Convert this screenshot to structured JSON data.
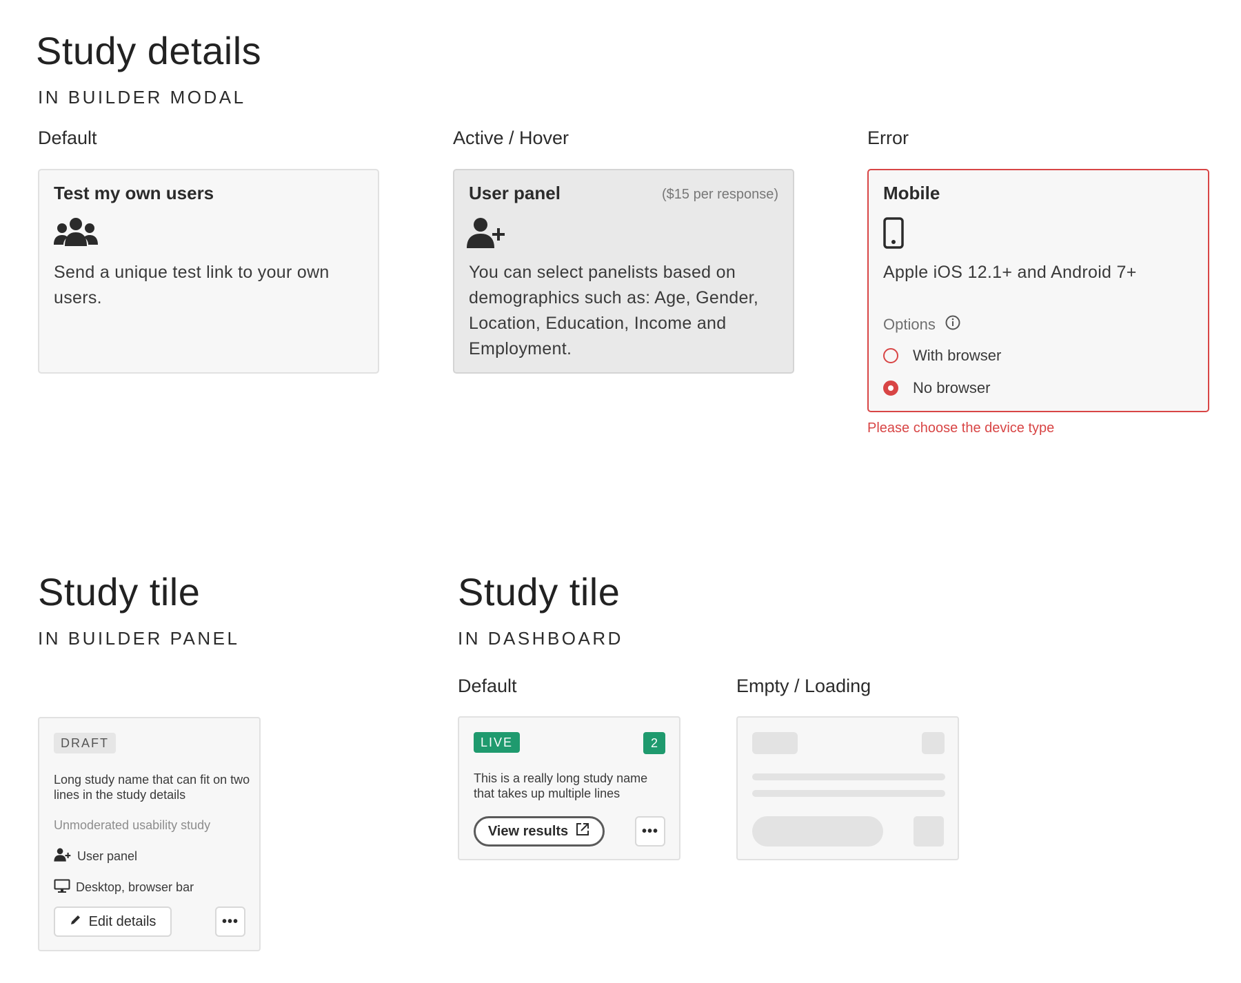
{
  "study_details": {
    "title": "Study details",
    "subtitle": "IN BUILDER MODAL",
    "states": {
      "default": "Default",
      "active": "Active / Hover",
      "error": "Error"
    },
    "cards": {
      "own_users": {
        "title": "Test my own users",
        "icon": "users-group-icon",
        "body": "Send a unique test link to your own users."
      },
      "user_panel": {
        "title": "User panel",
        "price": "($15 per response)",
        "icon": "user-plus-icon",
        "body": "You can select panelists based on demographics such as: Age, Gender, Location, Education, Income and Employment."
      },
      "mobile": {
        "title": "Mobile",
        "icon": "mobile-phone-icon",
        "body": "Apple iOS 12.1+ and Android 7+",
        "options_label": "Options",
        "options": [
          {
            "label": "With browser",
            "checked": false
          },
          {
            "label": "No browser",
            "checked": true
          }
        ],
        "error_message": "Please choose the device type"
      }
    }
  },
  "builder_tile": {
    "title": "Study tile",
    "subtitle": "IN BUILDER PANEL",
    "badge": "DRAFT",
    "name": "Long study name that can fit on two lines in the study details",
    "type": "Unmoderated usability study",
    "panel": "User panel",
    "device": "Desktop, browser bar",
    "edit_label": "Edit details"
  },
  "dashboard_tile": {
    "title": "Study tile",
    "subtitle": "IN DASHBOARD",
    "states": {
      "default": "Default",
      "empty": "Empty / Loading"
    },
    "badge": "LIVE",
    "count": "2",
    "name": "This is a really long study name that takes up multiple lines",
    "results_label": "View results"
  },
  "colors": {
    "error": "#d84545",
    "live": "#1f9a6e",
    "hover_bg": "#e9e9e9",
    "card_bg": "#f7f7f7"
  }
}
